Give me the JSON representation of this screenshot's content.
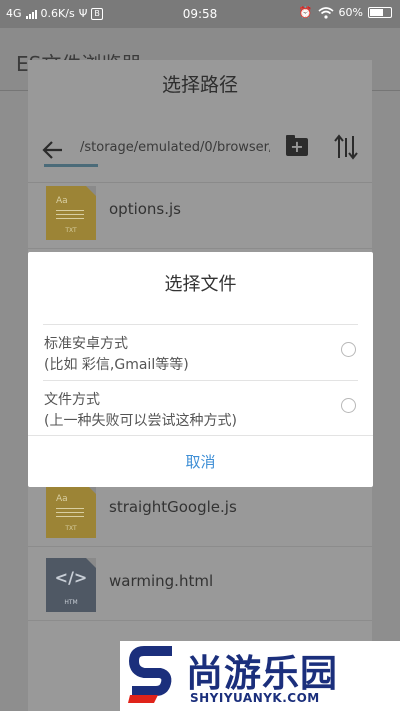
{
  "status_bar": {
    "network": "4G",
    "speed": "0.6K/s",
    "time": "09:58",
    "battery": "60%"
  },
  "app": {
    "title": "ES文件浏览器"
  },
  "path_picker": {
    "title": "选择路径",
    "path": "/storage/emulated/0/browser/…",
    "files": [
      {
        "name": "options.js",
        "type": "txt"
      },
      {
        "name": "straightGoogle.js",
        "type": "txt"
      },
      {
        "name": "warming.html",
        "type": "htm"
      }
    ]
  },
  "icons": {
    "txt_caption": "TXT",
    "htm_caption": "HTM",
    "txt_glyph": "Aa",
    "htm_glyph": "</>"
  },
  "dialog": {
    "title": "选择文件",
    "options": [
      {
        "line1": "标准安卓方式",
        "line2": "(比如 彩信,Gmail等等)"
      },
      {
        "line1": "文件方式",
        "line2": "(上一种失败可以尝试这种方式)"
      }
    ],
    "cancel": "取消"
  },
  "watermark": {
    "name": "尚游乐园",
    "domain": "SHYIYUANYK.COM"
  },
  "colors": {
    "accent": "#3f8fd6",
    "brand": "#1b2f7c",
    "brand_red": "#e0231a"
  }
}
